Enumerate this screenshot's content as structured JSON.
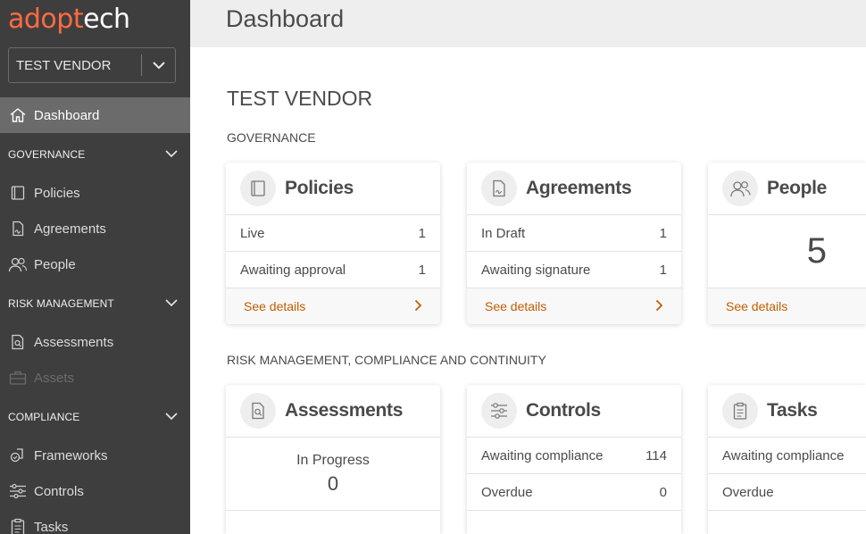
{
  "app": {
    "logo_part1": "adopt",
    "logo_part2": "ech"
  },
  "vendor_select": {
    "value": "TEST VENDOR"
  },
  "sidebar": {
    "dashboard": "Dashboard",
    "governance": {
      "label": "GOVERNANCE",
      "items": [
        "Policies",
        "Agreements",
        "People"
      ]
    },
    "risk": {
      "label": "RISK MANAGEMENT",
      "items": [
        "Assessments",
        "Assets"
      ]
    },
    "compliance": {
      "label": "COMPLIANCE",
      "items": [
        "Frameworks",
        "Controls",
        "Tasks"
      ]
    }
  },
  "header": {
    "title": "Dashboard"
  },
  "main": {
    "vendor_title": "TEST VENDOR",
    "section_governance": "GOVERNANCE",
    "section_risk": "RISK MANAGEMENT, COMPLIANCE AND CONTINUITY",
    "see_details": "See details",
    "policies": {
      "title": "Policies",
      "rows": [
        {
          "label": "Live",
          "value": "1"
        },
        {
          "label": "Awaiting approval",
          "value": "1"
        }
      ]
    },
    "agreements": {
      "title": "Agreements",
      "rows": [
        {
          "label": "In Draft",
          "value": "1"
        },
        {
          "label": "Awaiting signature",
          "value": "1"
        }
      ]
    },
    "people": {
      "title": "People",
      "count": "5"
    },
    "assessments": {
      "title": "Assessments",
      "status_label": "In Progress",
      "status_value": "0"
    },
    "controls": {
      "title": "Controls",
      "rows": [
        {
          "label": "Awaiting compliance",
          "value": "114"
        },
        {
          "label": "Overdue",
          "value": "0"
        }
      ]
    },
    "tasks": {
      "title": "Tasks",
      "rows": [
        {
          "label": "Awaiting compliance",
          "value": ""
        },
        {
          "label": "Overdue",
          "value": ""
        }
      ]
    }
  },
  "colors": {
    "sidebar_bg": "#3e3e3e",
    "accent": "#c15e00",
    "logo_orange": "#ff6b40",
    "active_item": "#6b6b6b"
  }
}
